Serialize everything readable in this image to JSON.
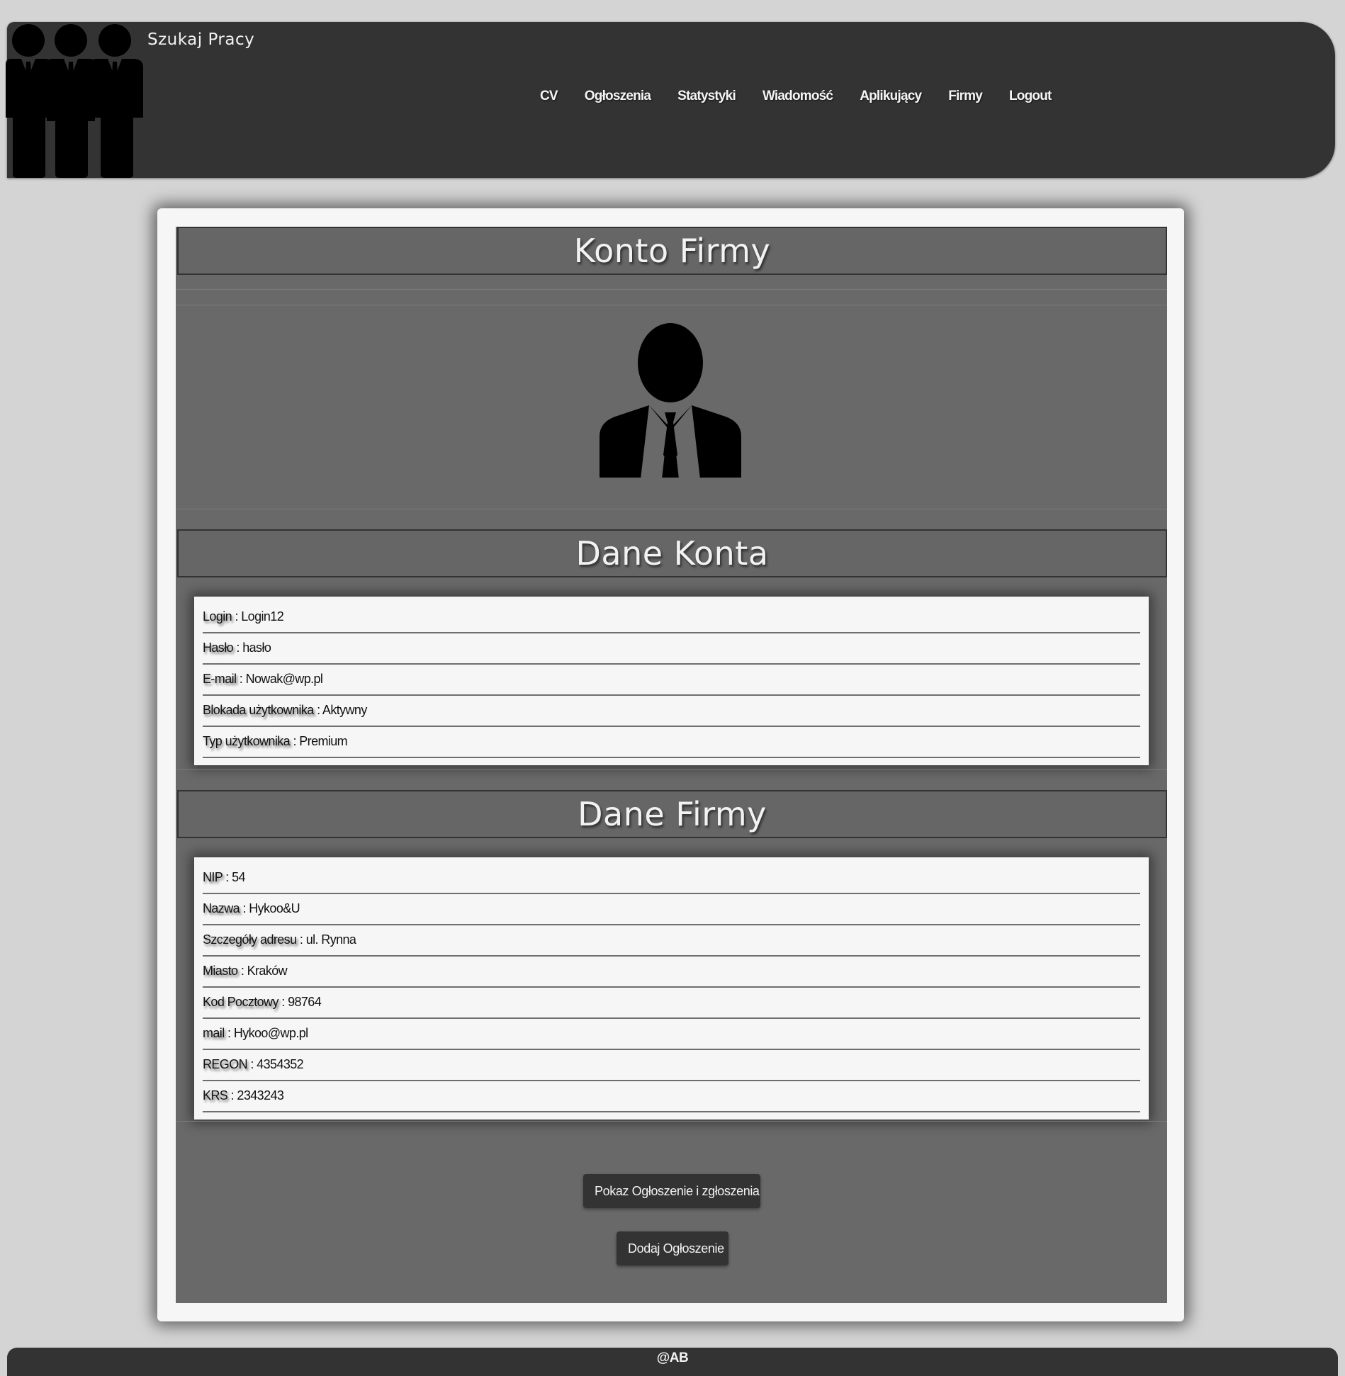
{
  "site": {
    "title": "Szukaj Pracy",
    "logo_icon": "people-group-icon"
  },
  "nav": {
    "items": [
      {
        "label": "CV"
      },
      {
        "label": "Ogłoszenia"
      },
      {
        "label": "Statystyki"
      },
      {
        "label": "Wiadomość"
      },
      {
        "label": "Aplikujący"
      },
      {
        "label": "Firmy"
      },
      {
        "label": "Logout"
      }
    ]
  },
  "account": {
    "page_title": "Konto Firmy",
    "avatar_icon": "businessman-avatar-icon",
    "account_section_title": "Dane Konta",
    "account_fields": [
      {
        "key": "Login",
        "value": "Login12"
      },
      {
        "key": "Hasło",
        "value": "hasło"
      },
      {
        "key": "E-mail",
        "value": "Nowak@wp.pl"
      },
      {
        "key": "Blokada użytkownika",
        "value": "Aktywny"
      },
      {
        "key": "Typ użytkownika",
        "value": "Premium"
      }
    ],
    "company_section_title": "Dane Firmy",
    "company_fields": [
      {
        "key": "NIP",
        "value": "54"
      },
      {
        "key": "Nazwa",
        "value": "Hykoo&U"
      },
      {
        "key": "Szczegóły adresu",
        "value": "ul. Rynna"
      },
      {
        "key": "Miasto",
        "value": "Kraków"
      },
      {
        "key": "Kod Pocztowy",
        "value": "98764"
      },
      {
        "key": "mail",
        "value": "Hykoo@wp.pl"
      },
      {
        "key": "REGON",
        "value": "4354352"
      },
      {
        "key": "KRS",
        "value": "2343243"
      }
    ],
    "separator": " : "
  },
  "actions": {
    "show_ads_label": "Pokaz Ogłoszenie i zgłoszenia",
    "add_ad_label": "Dodaj Ogłoszenie"
  },
  "footer": {
    "text": "@AB"
  },
  "colors": {
    "background": "#d4d4d4",
    "header": "#333333",
    "panel": "#696969",
    "card": "#f6f6f6"
  }
}
